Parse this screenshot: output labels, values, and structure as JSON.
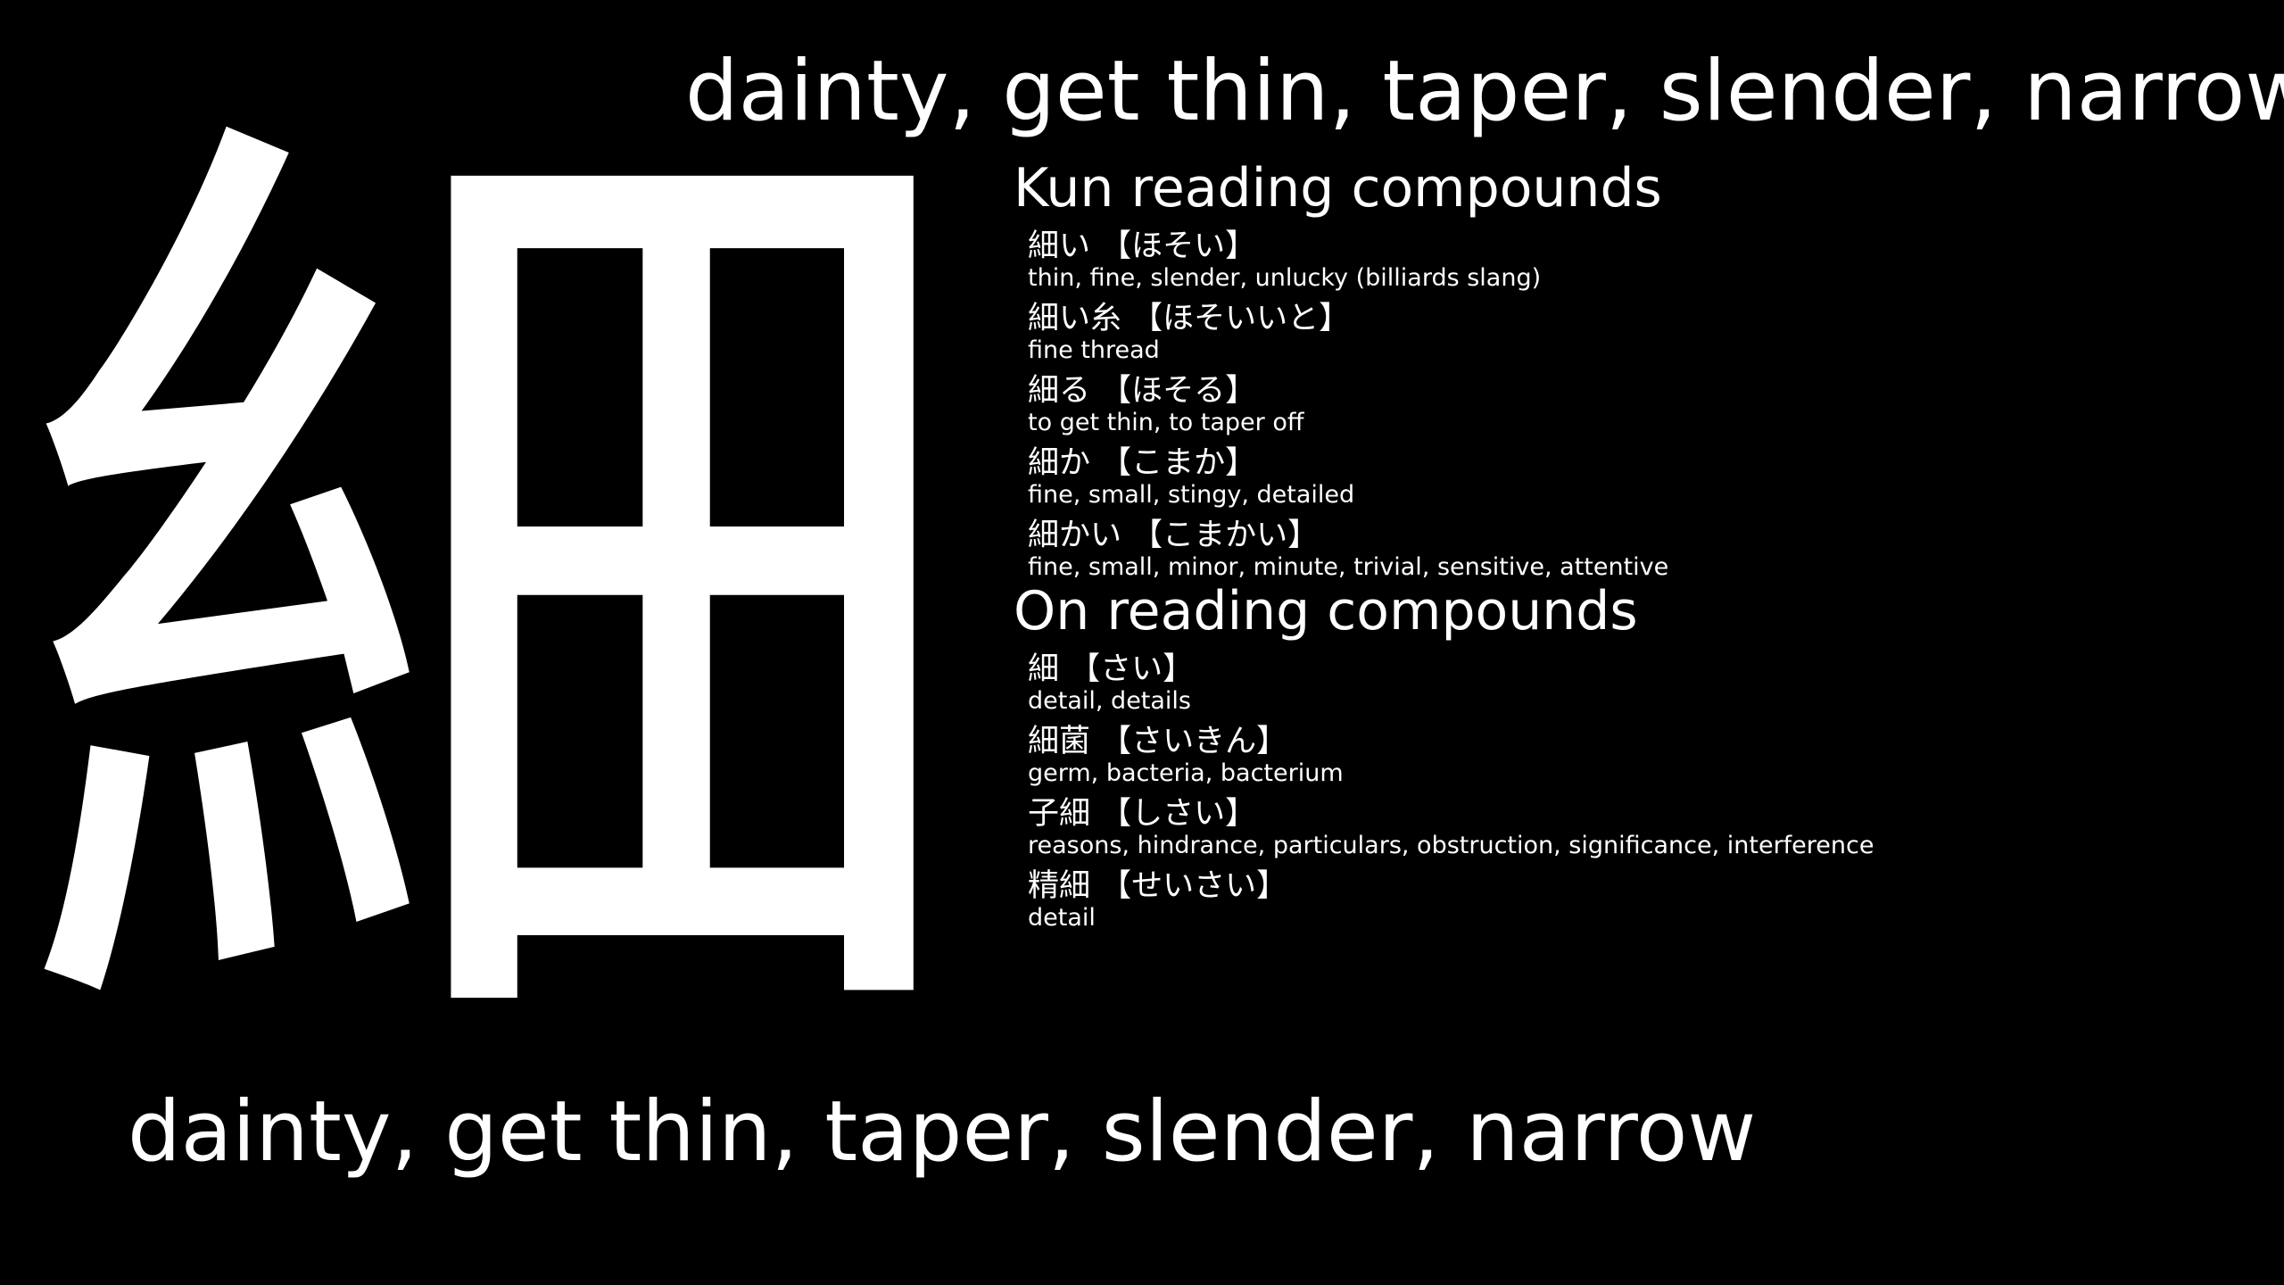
{
  "kanji": "細",
  "meaning_top": "dainty, get thin, taper, slender, narrow",
  "meaning_bottom": "dainty, get thin, taper, slender, narrow",
  "kun": {
    "heading": "Kun reading compounds",
    "entries": [
      {
        "word": "細い 【ほそい】",
        "meaning": "thin, fine, slender, unlucky (billiards slang)"
      },
      {
        "word": "細い糸 【ほそいいと】",
        "meaning": "fine thread"
      },
      {
        "word": "細る 【ほそる】",
        "meaning": "to get thin, to taper off"
      },
      {
        "word": "細か 【こまか】",
        "meaning": "fine, small, stingy, detailed"
      },
      {
        "word": "細かい 【こまかい】",
        "meaning": "fine, small, minor, minute, trivial, sensitive, attentive"
      }
    ]
  },
  "on": {
    "heading": "On reading compounds",
    "entries": [
      {
        "word": "細 【さい】",
        "meaning": "detail, details"
      },
      {
        "word": "細菌 【さいきん】",
        "meaning": "germ, bacteria, bacterium"
      },
      {
        "word": "子細 【しさい】",
        "meaning": "reasons, hindrance, particulars, obstruction, significance, interference"
      },
      {
        "word": "精細 【せいさい】",
        "meaning": "detail"
      }
    ]
  }
}
